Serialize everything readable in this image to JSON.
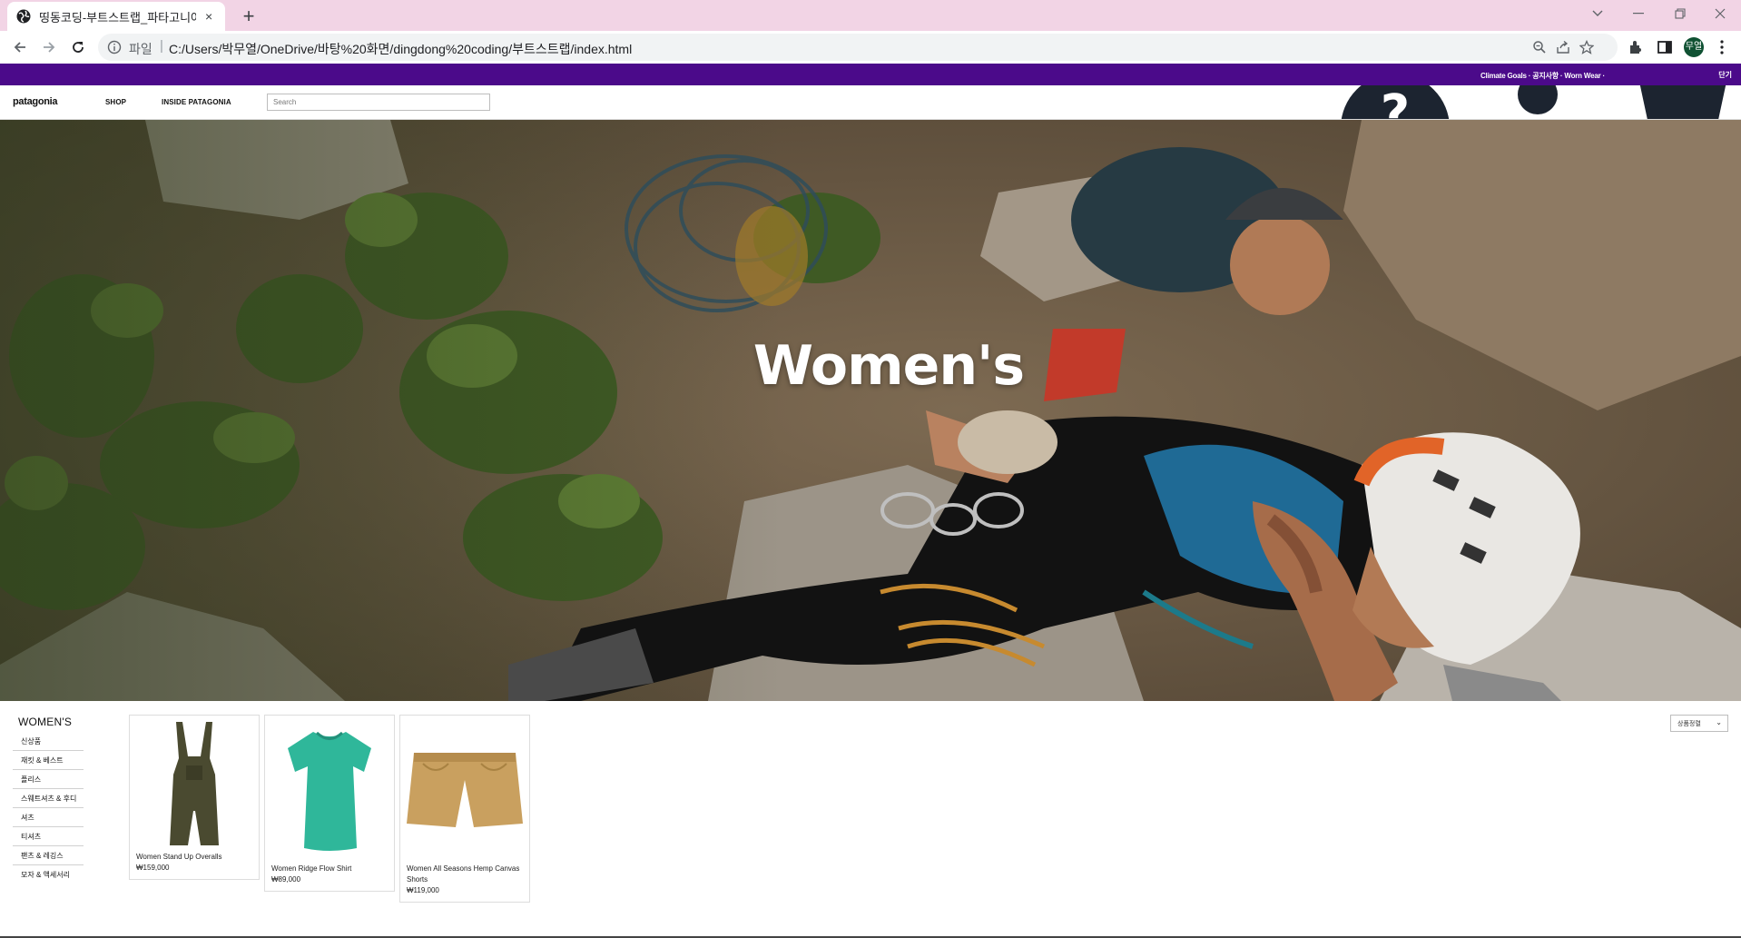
{
  "browser": {
    "tab_title": "띵동코딩-부트스트랩_파타고니아",
    "tab_close": "×",
    "new_tab": "+",
    "url_scheme": "파일",
    "url_separator": "|",
    "url": "C:/Users/박무열/OneDrive/바탕%20화면/dingdong%20coding/부트스트랩/index.html",
    "profile_initials": "무열"
  },
  "promo": {
    "text": "Climate Goals · 공지사항 · Worn Wear ·",
    "cut_text": "단기"
  },
  "header": {
    "logo": "patagonia",
    "nav": [
      "SHOP",
      "INSIDE PATAGONIA"
    ],
    "search_placeholder": "Search"
  },
  "hero": {
    "title": "Women's"
  },
  "sidebar": {
    "title": "WOMEN'S",
    "items": [
      "신상품",
      "재킷 & 베스트",
      "플리스",
      "스웨트셔츠 & 후디",
      "셔츠",
      "티셔츠",
      "팬츠 & 레깅스",
      "모자 & 액세서리"
    ]
  },
  "products": [
    {
      "name": "Women Stand Up Overalls",
      "price": "₩159,000",
      "image_icon": "overalls-icon",
      "color": "#4a4a30"
    },
    {
      "name": "Women Ridge Flow Shirt",
      "price": "₩89,000",
      "image_icon": "tshirt-icon",
      "color": "#2fb79a"
    },
    {
      "name": "Women All Seasons Hemp Canvas Shorts",
      "price": "₩119,000",
      "image_icon": "shorts-icon",
      "color": "#c9a05f"
    }
  ],
  "sort": {
    "label": "상품정렬"
  },
  "colors": {
    "promo": "#4b0a8a",
    "tabstrip": "#f2d4e5"
  }
}
